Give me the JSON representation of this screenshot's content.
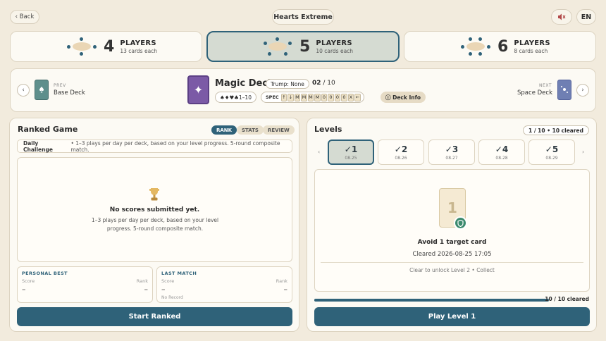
{
  "topbar": {
    "back": "‹ Back",
    "title": "Hearts Extreme",
    "lang": "EN"
  },
  "players": [
    {
      "num": "4",
      "label": "PLAYERS",
      "sub": "13 cards each",
      "selected": false
    },
    {
      "num": "5",
      "label": "PLAYERS",
      "sub": "10 cards each",
      "selected": true
    },
    {
      "num": "6",
      "label": "PLAYERS",
      "sub": "8 cards each",
      "selected": false
    }
  ],
  "deck": {
    "prev_label": "PREV",
    "prev_name": "Base Deck",
    "next_label": "NEXT",
    "next_name": "Space Deck",
    "name": "Magic Deck",
    "trump": "Trump: None",
    "progress_cur": "02",
    "progress_total": "/ 10",
    "suits": "♠♦♥♣1–10",
    "spec_label": "SPEC",
    "spec_items": [
      "↑",
      "↓",
      "M",
      "M",
      "M",
      "M",
      "0",
      "0",
      "0",
      "0",
      "X",
      "←"
    ],
    "info": "ⓘ Deck Info"
  },
  "ranked": {
    "title": "Ranked Game",
    "tabs": [
      "RANK",
      "STATS",
      "REVIEW"
    ],
    "daily_label": "Daily Challenge",
    "daily_text": "• 1–3 plays per day per deck, based on your level progress. 5-round composite match.",
    "empty_title": "No scores submitted yet.",
    "empty_sub": "1–3 plays per day per deck, based on your level progress. 5-round composite match.",
    "best": {
      "title": "PERSONAL BEST",
      "score_label": "Score",
      "rank_label": "Rank",
      "score": "–",
      "rank": "–"
    },
    "last": {
      "title": "LAST MATCH",
      "score_label": "Score",
      "rank_label": "Rank",
      "score": "–",
      "rank": "–",
      "note": "No Record"
    },
    "button": "Start Ranked"
  },
  "levels": {
    "title": "Levels",
    "count": "1 / 10 • 10 cleared",
    "items": [
      {
        "n": "✓1",
        "date": "08.25"
      },
      {
        "n": "✓2",
        "date": "08.26"
      },
      {
        "n": "✓3",
        "date": "08.27"
      },
      {
        "n": "✓4",
        "date": "08.28"
      },
      {
        "n": "✓5",
        "date": "08.29"
      }
    ],
    "card_num": "1",
    "goal": "Avoid 1 target card",
    "cleared": "Cleared 2026-08-25 17:05",
    "unlock": "Clear to unlock Level 2  •  Collect",
    "progress_text": "10 / 10 cleared",
    "progress": 1.0,
    "button": "Play Level 1"
  },
  "colors": {
    "accent": "#2f6279",
    "background": "#f2ebdd",
    "magic": "#7b5aa6"
  }
}
